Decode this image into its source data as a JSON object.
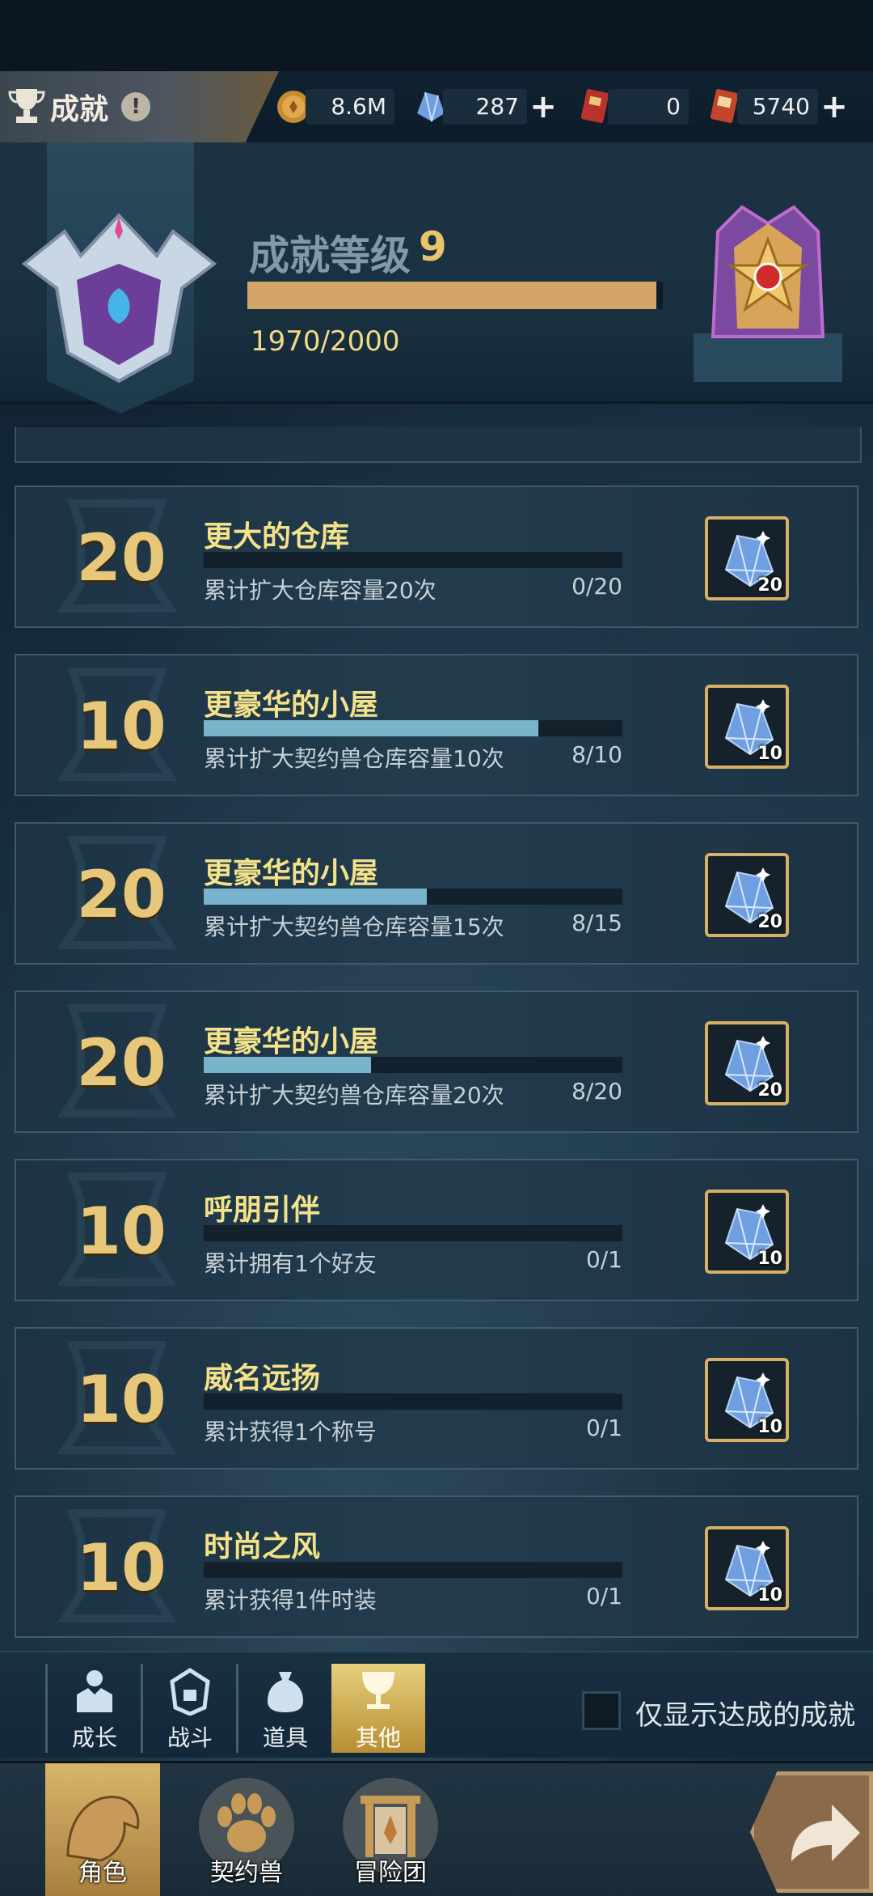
{
  "header": {
    "title": "成就",
    "info_glyph": "!",
    "level_label": "成就等级",
    "level_value": "9",
    "progress_text": "1970/2000",
    "progress_fraction": 0.985
  },
  "resources": [
    {
      "icon": "gold-coin-icon",
      "value": "8.6M",
      "has_plus": false
    },
    {
      "icon": "crystal-icon",
      "value": "287",
      "has_plus": true
    },
    {
      "icon": "red-card-icon",
      "value": "0",
      "has_plus": false
    },
    {
      "icon": "ticket-card-icon",
      "value": "5740",
      "has_plus": true
    }
  ],
  "achievements": [
    {
      "points": "20",
      "name": "更大的仓库",
      "desc": "累计扩大仓库容量20次",
      "progress": "0/20",
      "fraction": 0.0,
      "reward_qty": "20"
    },
    {
      "points": "10",
      "name": "更豪华的小屋",
      "desc": "累计扩大契约兽仓库容量10次",
      "progress": "8/10",
      "fraction": 0.8,
      "reward_qty": "10"
    },
    {
      "points": "20",
      "name": "更豪华的小屋",
      "desc": "累计扩大契约兽仓库容量15次",
      "progress": "8/15",
      "fraction": 0.533,
      "reward_qty": "20"
    },
    {
      "points": "20",
      "name": "更豪华的小屋",
      "desc": "累计扩大契约兽仓库容量20次",
      "progress": "8/20",
      "fraction": 0.4,
      "reward_qty": "20"
    },
    {
      "points": "10",
      "name": "呼朋引伴",
      "desc": "累计拥有1个好友",
      "progress": "0/1",
      "fraction": 0.0,
      "reward_qty": "10"
    },
    {
      "points": "10",
      "name": "威名远扬",
      "desc": "累计获得1个称号",
      "progress": "0/1",
      "fraction": 0.0,
      "reward_qty": "10"
    },
    {
      "points": "10",
      "name": "时尚之风",
      "desc": "累计获得1件时装",
      "progress": "0/1",
      "fraction": 0.0,
      "reward_qty": "10"
    }
  ],
  "categories": [
    {
      "label": "成长",
      "icon": "growth-icon",
      "active": false
    },
    {
      "label": "战斗",
      "icon": "battle-helmet-icon",
      "active": false
    },
    {
      "label": "道具",
      "icon": "item-bag-icon",
      "active": false
    },
    {
      "label": "其他",
      "icon": "goblet-icon",
      "active": true
    }
  ],
  "filter": {
    "label": "仅显示达成的成就",
    "checked": false
  },
  "bottom_nav": [
    {
      "label": "角色",
      "icon": "character-icon",
      "active": true
    },
    {
      "label": "契约兽",
      "icon": "paw-icon",
      "active": false
    },
    {
      "label": "冒险团",
      "icon": "adventure-guild-icon",
      "active": false
    }
  ],
  "colors": {
    "accent_gold": "#e7c77a",
    "progress_blue": "#79b3cc",
    "level_bar": "#d3a468"
  }
}
